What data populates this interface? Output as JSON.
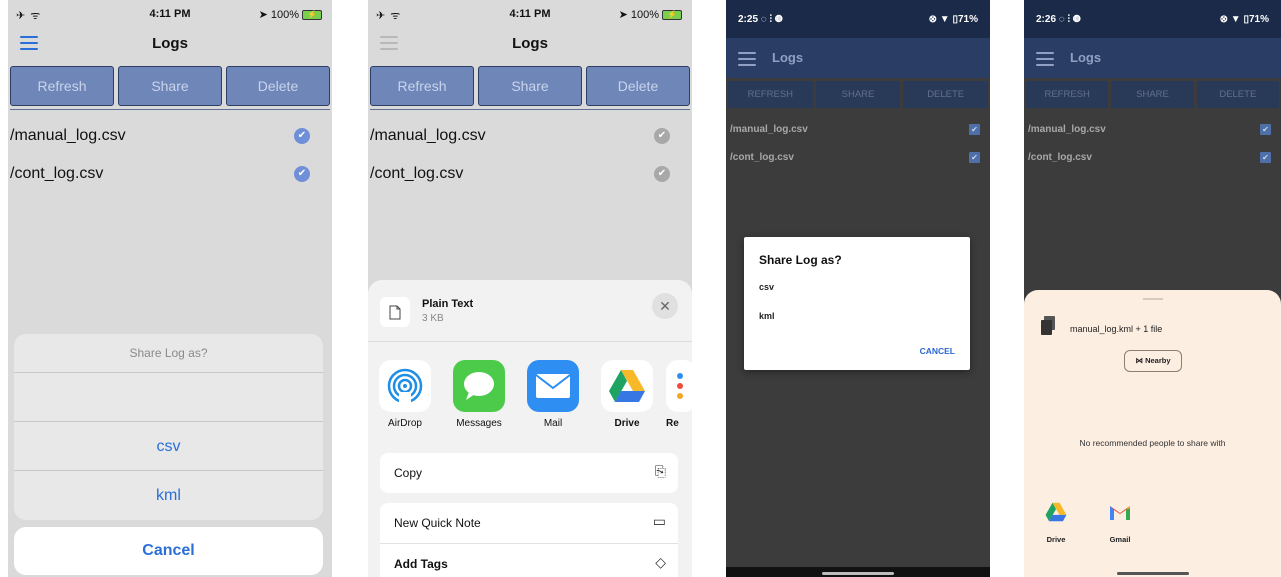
{
  "screen1": {
    "status": {
      "left": "✈ ᯤ",
      "time": "4:11 PM",
      "right": "➤ 100%"
    },
    "title": "Logs",
    "buttons": {
      "refresh": "Refresh",
      "share": "Share",
      "delete": "Delete"
    },
    "files": [
      "/manual_log.csv",
      "/cont_log.csv"
    ],
    "sheet": {
      "header": "Share Log as?",
      "opt1": "csv",
      "opt2": "kml",
      "cancel": "Cancel"
    },
    "colors": {
      "accent": "#2b6fd6",
      "button_fill": "#6f86b8"
    }
  },
  "screen2": {
    "status": {
      "left": "✈ ᯤ",
      "time": "4:11 PM",
      "right": "➤ 100%"
    },
    "title": "Logs",
    "buttons": {
      "refresh": "Refresh",
      "share": "Share",
      "delete": "Delete"
    },
    "files": [
      "/manual_log.csv",
      "/cont_log.csv"
    ],
    "share": {
      "doc_title": "Plain Text",
      "doc_size": "3 KB",
      "apps": [
        "AirDrop",
        "Messages",
        "Mail",
        "Drive",
        "Re"
      ],
      "copy": "Copy",
      "quick_note": "New Quick Note",
      "add_tags": "Add Tags"
    }
  },
  "screen3": {
    "status": {
      "time": "2:25 ◌ ⫶ ◍",
      "right": "⊗ ▼ ▯71%"
    },
    "title": "Logs",
    "buttons": {
      "refresh": "REFRESH",
      "share": "SHARE",
      "delete": "DELETE"
    },
    "files": [
      "/manual_log.csv",
      "/cont_log.csv"
    ],
    "dialog": {
      "title": "Share Log as?",
      "opt1": "csv",
      "opt2": "kml",
      "cancel": "CANCEL"
    }
  },
  "screen4": {
    "status": {
      "time": "2:26 ◌ ⫶ ◍",
      "right": "⊗ ▼ ▯71%"
    },
    "title": "Logs",
    "buttons": {
      "refresh": "REFRESH",
      "share": "SHARE",
      "delete": "DELETE"
    },
    "files": [
      "/manual_log.csv",
      "/cont_log.csv"
    ],
    "sheet": {
      "files_label": "manual_log.kml + 1 file",
      "nearby": "Nearby",
      "no_recommend": "No recommended people to share with",
      "apps": [
        "Drive",
        "Gmail"
      ]
    }
  }
}
